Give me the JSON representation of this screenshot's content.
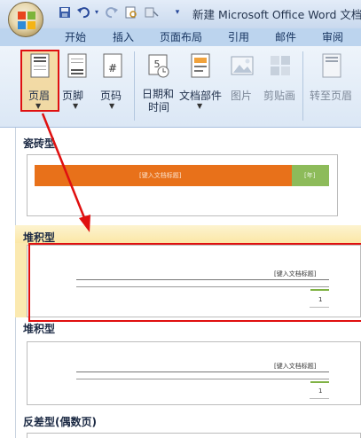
{
  "window": {
    "title": "新建 Microsoft Office Word 文档"
  },
  "tabs": [
    "开始",
    "插入",
    "页面布局",
    "引用",
    "邮件",
    "审阅"
  ],
  "ribbon": {
    "header": "页眉",
    "footer": "页脚",
    "page_number": "页码",
    "date_time_line1": "日期和",
    "date_time_line2": "时间",
    "quick_parts": "文档部件",
    "picture": "图片",
    "clip_art": "剪贴画",
    "goto_header": "转至页眉"
  },
  "gallery": {
    "sections": [
      {
        "title": "瓷砖型",
        "doc_title_placeholder": "[键入文档标题]",
        "year_placeholder": "[年]"
      },
      {
        "title": "堆积型",
        "doc_title_placeholder": "[键入文档标题]",
        "page_num": "1"
      },
      {
        "title": "堆积型",
        "doc_title_placeholder": "[键入文档标题]",
        "page_num": "1"
      },
      {
        "title": "反差型(偶数页)"
      }
    ]
  },
  "colors": {
    "highlight": "#e01010",
    "tile_orange": "#e8711a",
    "tile_green": "#8dbb5a",
    "section_band": "#fbe6a2"
  },
  "icons": [
    "office-button-icon",
    "save-icon",
    "undo-icon",
    "redo-icon",
    "print-preview-icon",
    "quick-access-icon",
    "header-icon",
    "footer-icon",
    "page-number-icon",
    "date-time-icon",
    "quick-parts-icon",
    "picture-icon",
    "clip-art-icon",
    "goto-header-icon"
  ]
}
